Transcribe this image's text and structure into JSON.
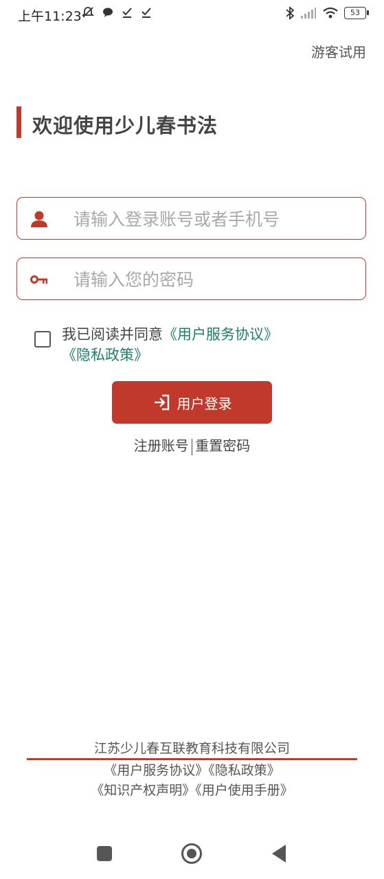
{
  "status_bar": {
    "time": "上午11:23",
    "battery": "53"
  },
  "guest_trial": "游客试用",
  "welcome_title": "欢迎使用少儿春书法",
  "login_form": {
    "account_placeholder": "请输入登录账号或者手机号",
    "password_placeholder": "请输入您的密码"
  },
  "agreement": {
    "prefix": "我已阅读并同意",
    "user_agreement": "《用户服务协议》",
    "privacy_policy": "《隐私政策》"
  },
  "login_button": "用户登录",
  "links": {
    "register": "注册账号",
    "reset_password": "重置密码"
  },
  "footer": {
    "company": "江苏少儿春互联教育科技有限公司",
    "user_agreement": "《用户服务协议》",
    "privacy_policy": "《隐私政策》",
    "ip_statement": "《知识产权声明》",
    "user_manual": "《用户使用手册》"
  },
  "colors": {
    "accent": "#c0392b",
    "link": "#1b7f6f"
  }
}
